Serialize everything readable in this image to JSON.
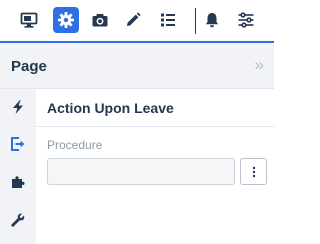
{
  "toolbar": {
    "items": [
      {
        "icon": "monitor-icon",
        "active": false
      },
      {
        "icon": "gear-icon",
        "active": true
      },
      {
        "icon": "camera-icon",
        "active": false
      },
      {
        "icon": "pencil-icon",
        "active": false
      },
      {
        "icon": "list-icon",
        "active": false
      },
      {
        "icon": "bell-icon",
        "active": false
      },
      {
        "icon": "sliders-icon",
        "active": false
      }
    ],
    "accent_color": "#2f6fe4"
  },
  "header": {
    "title": "Page",
    "collapse_glyph": "»"
  },
  "siderail": {
    "items": [
      {
        "icon": "lightning-icon",
        "active": false
      },
      {
        "icon": "exit-icon",
        "active": true
      },
      {
        "icon": "puzzle-icon",
        "active": false
      },
      {
        "icon": "wrench-icon",
        "active": false
      }
    ]
  },
  "panel": {
    "section_title": "Action Upon Leave",
    "field_label": "Procedure",
    "field_value": ""
  }
}
